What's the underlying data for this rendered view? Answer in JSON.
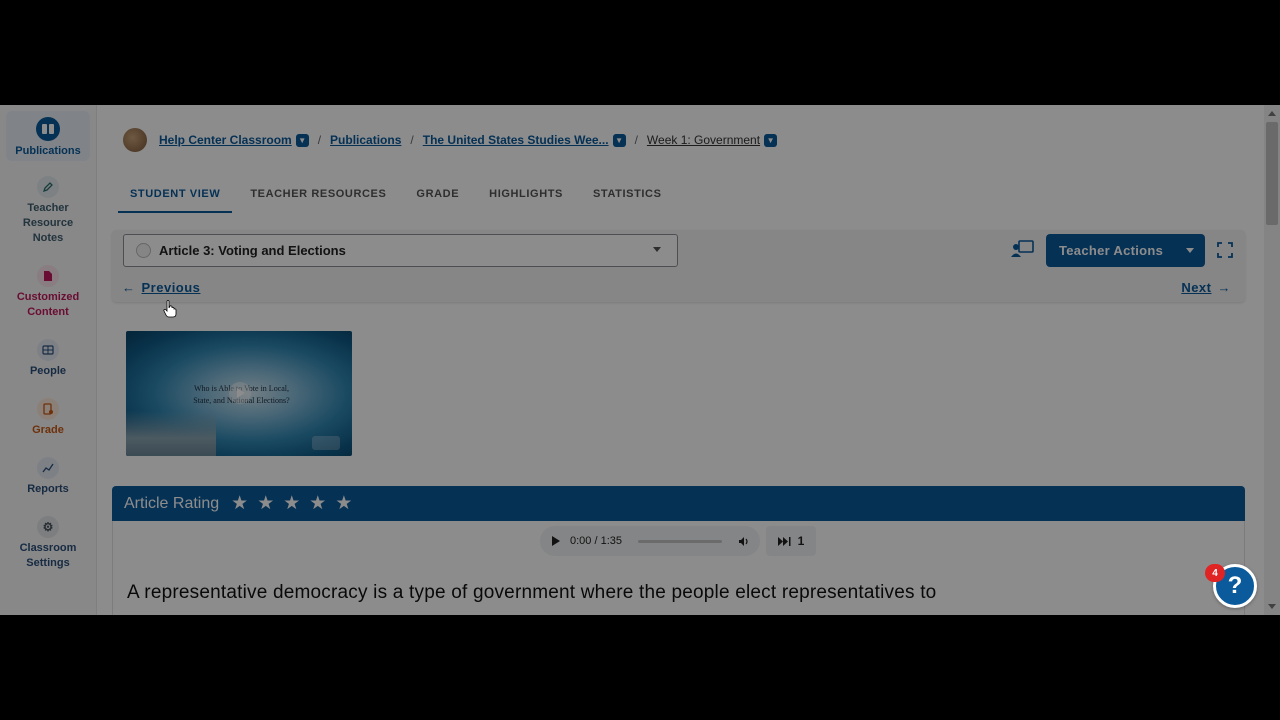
{
  "sidebar": {
    "items": [
      {
        "label": "Publications",
        "icon": "book-icon",
        "active": true
      },
      {
        "label": "Teacher Resource Notes",
        "icon": "pen-icon"
      },
      {
        "label": "Customized Content",
        "icon": "document-icon"
      },
      {
        "label": "People",
        "icon": "people-icon"
      },
      {
        "label": "Grade",
        "icon": "gradebook-icon"
      },
      {
        "label": "Reports",
        "icon": "line-chart-icon"
      },
      {
        "label": "Classroom Settings",
        "icon": "gear-icon"
      }
    ]
  },
  "breadcrumb": {
    "items": [
      "Help Center Classroom",
      "Publications",
      "The United States Studies Wee...",
      "Week 1: Government"
    ],
    "separator": "/"
  },
  "tabs": [
    "STUDENT VIEW",
    "TEACHER RESOURCES",
    "GRADE",
    "HIGHLIGHTS",
    "STATISTICS"
  ],
  "active_tab": "STUDENT VIEW",
  "toolbar": {
    "article_select_value": "Article 3: Voting and Elections",
    "teacher_actions_label": "Teacher Actions",
    "previous_label": "Previous",
    "next_label": "Next"
  },
  "video": {
    "title_line1": "Who is Able to Vote in Local,",
    "title_line2": "State, and National Elections?"
  },
  "rating": {
    "label": "Article Rating",
    "stars": 5
  },
  "audio": {
    "time": "0:00 / 1:35",
    "speed": "1"
  },
  "article": {
    "text": "A representative democracy is a type of government where the people elect representatives to"
  },
  "help": {
    "badge_count": "4",
    "symbol": "?"
  },
  "colors": {
    "primary": "#0a5a9c",
    "customized": "#c2185b",
    "grade": "#c85a14",
    "badge": "#e02424"
  }
}
